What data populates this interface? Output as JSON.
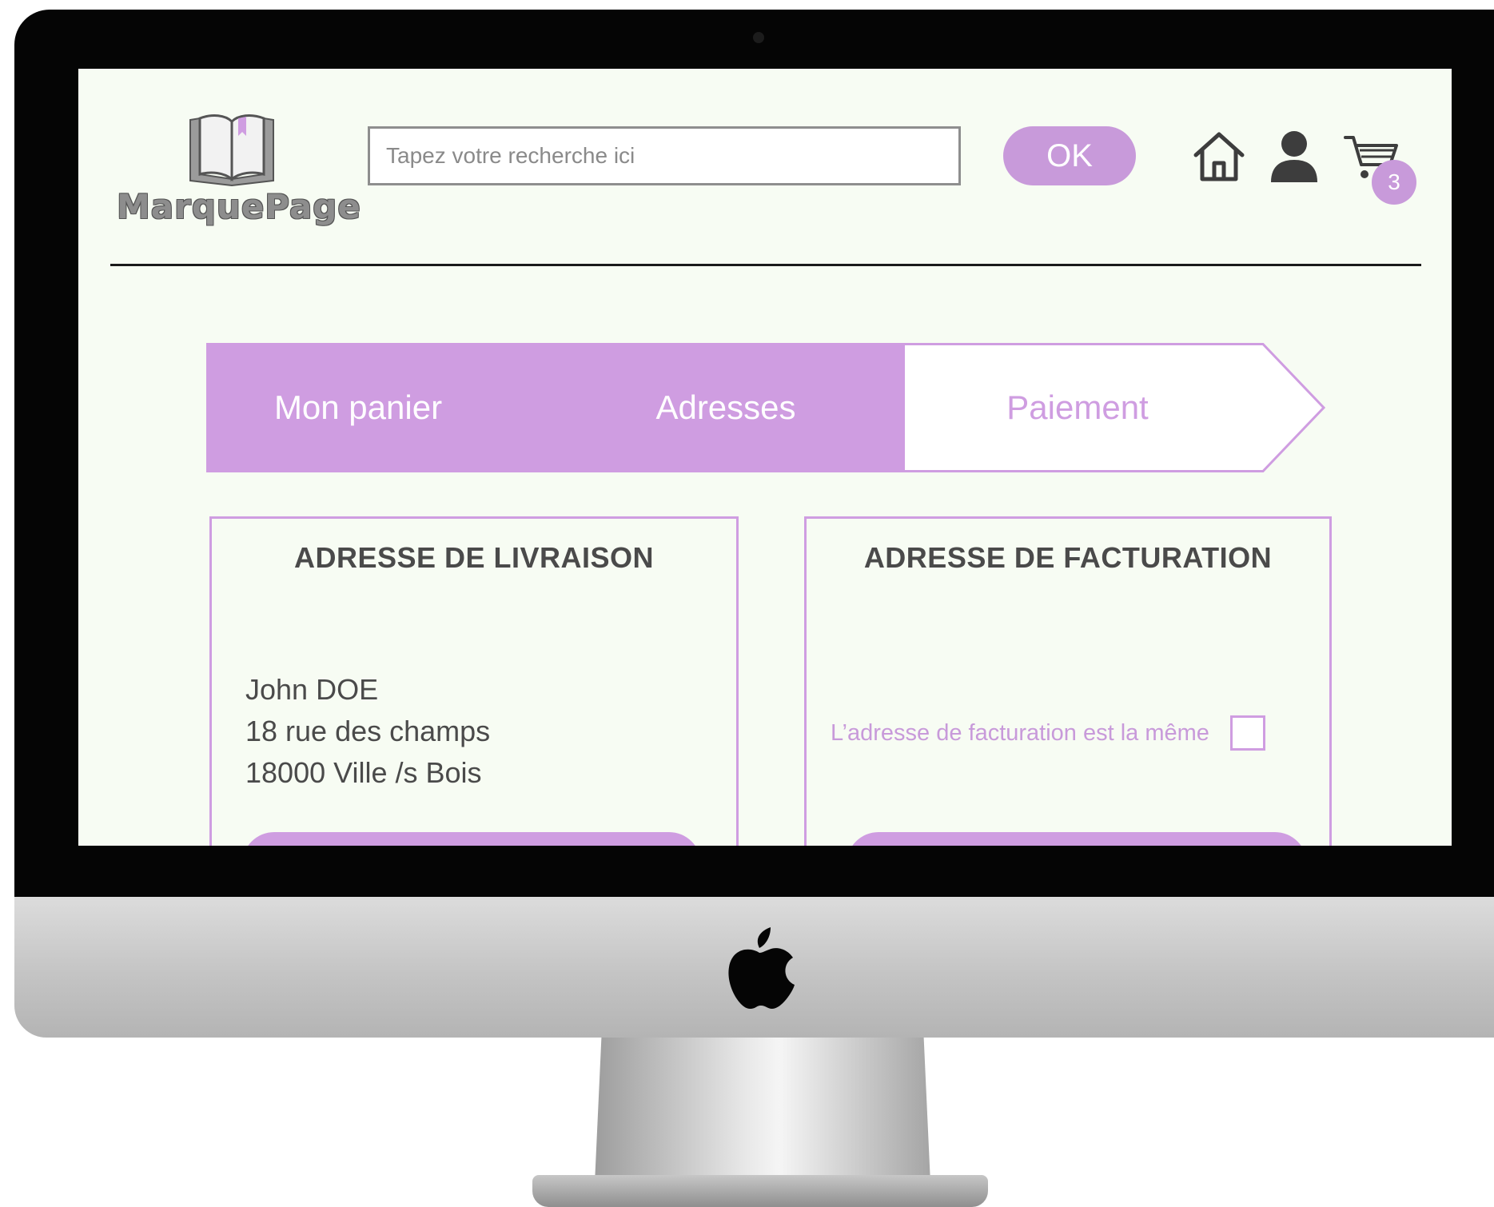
{
  "brand": {
    "name": "MarquePage"
  },
  "search": {
    "placeholder": "Tapez votre recherche ici",
    "value": ""
  },
  "header": {
    "ok_label": "OK",
    "cart_count": "3"
  },
  "stepper": {
    "steps": [
      {
        "label": "Mon panier",
        "state": "done"
      },
      {
        "label": "Adresses",
        "state": "current"
      },
      {
        "label": "Paiement",
        "state": "upcoming"
      }
    ]
  },
  "delivery": {
    "title": "ADRESSE DE LIVRAISON",
    "lines": [
      "John DOE",
      "18 rue des champs",
      "18000 Ville /s Bois"
    ]
  },
  "billing": {
    "title": "ADRESSE DE FACTURATION",
    "same_address_label": "L’adresse de facturation est la même",
    "same_address_checked": false
  },
  "colors": {
    "accent": "#cf9de1",
    "screen_background": "#f7fcf3",
    "text": "#4a4a4a"
  },
  "icons": [
    "home-icon",
    "user-icon",
    "cart-icon",
    "book-icon",
    "apple-icon"
  ]
}
